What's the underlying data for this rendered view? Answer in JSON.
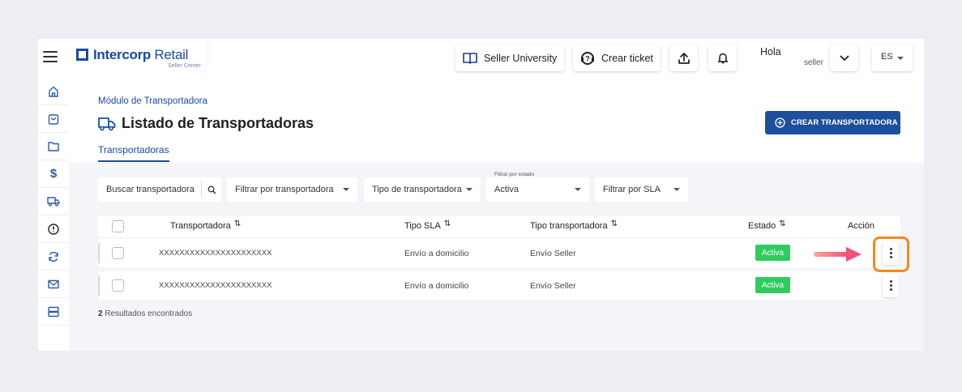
{
  "header": {
    "logo_text_bold": "Intercorp",
    "logo_text_light": " Retail",
    "logo_sub": "Seller Center",
    "seller_university": "Seller University",
    "crear_ticket": "Crear ticket",
    "greeting": "Hola",
    "user": "seller",
    "language": "ES"
  },
  "sidebar": {
    "items": [
      {
        "icon": "home-icon"
      },
      {
        "icon": "shopping-bag-icon"
      },
      {
        "icon": "folder-icon"
      },
      {
        "icon": "dollar-icon",
        "glyph": "$"
      },
      {
        "icon": "truck-icon"
      },
      {
        "icon": "alert-circle-icon"
      },
      {
        "icon": "refresh-icon"
      },
      {
        "icon": "mail-icon"
      },
      {
        "icon": "server-icon"
      }
    ]
  },
  "page": {
    "breadcrumb": "Módulo de Transportadora",
    "title": "Listado de Transportadoras",
    "tab": "Transportadoras",
    "create_button": "CREAR TRANSPORTADORA"
  },
  "filters": {
    "search_placeholder": "Buscar transportadora",
    "by_carrier": "Filtrar por transportadora",
    "carrier_type": "Tipo de transportadora",
    "status_label": "Filtrar por estado",
    "status_value": "Activa",
    "by_sla": "Filtrar por SLA"
  },
  "table": {
    "columns": [
      "Transportadora",
      "Tipo SLA",
      "Tipo transportadora",
      "Estado",
      "Acción"
    ],
    "rows": [
      {
        "name": "XXXXXXXXXXXXXXXXXXXXXX",
        "sla": "Envío a domicilio",
        "type": "Envío Seller",
        "status": "Activa"
      },
      {
        "name": "XXXXXXXXXXXXXXXXXXXXXX",
        "sla": "Envío a domicilio",
        "type": "Envío Seller",
        "status": "Activa"
      }
    ]
  },
  "results": {
    "count": "2",
    "label": " Resultados encontrados"
  },
  "colors": {
    "primary": "#1d4f9c",
    "active_badge": "#2ecc5f",
    "highlight": "#f08a1d",
    "arrow": "#f0507a"
  }
}
